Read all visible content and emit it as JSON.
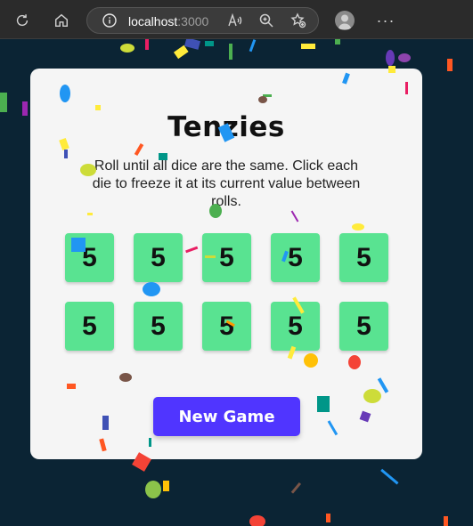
{
  "browser": {
    "url_host": "localhost",
    "url_port": ":3000",
    "more_label": "···"
  },
  "game": {
    "title": "Tenzies",
    "instructions": "Roll until all dice are the same. Click each die to freeze it at its current value between rolls.",
    "dice": [
      "5",
      "5",
      "5",
      "5",
      "5",
      "5",
      "5",
      "5",
      "5",
      "5"
    ],
    "button_label": "New Game"
  },
  "colors": {
    "background": "#0b2434",
    "card": "#f5f5f5",
    "die_held": "#59e391",
    "button": "#5035ff"
  }
}
